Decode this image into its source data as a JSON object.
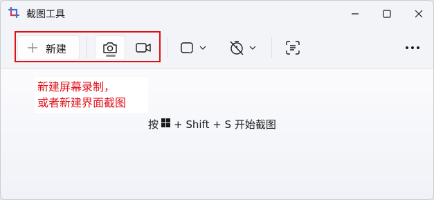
{
  "window": {
    "title": "截图工具",
    "icon": "snipping-tool-icon",
    "controls": [
      "minimize-icon",
      "maximize-icon",
      "close-icon"
    ]
  },
  "toolbar": {
    "new_label": "新建",
    "new_icon": "plus-icon",
    "modes": [
      {
        "name": "camera",
        "icon": "camera-icon",
        "selected": true
      },
      {
        "name": "video",
        "icon": "video-camera-icon",
        "selected": false
      }
    ],
    "tools": [
      "snip-shape-icon",
      "chevron-down-icon",
      "timer-icon",
      "chevron-down-icon",
      "text-actions-icon",
      "more-icon"
    ]
  },
  "annotation": {
    "line1": "新建屏幕录制，",
    "line2": "或者新建界面截图",
    "color": "#e0111a"
  },
  "hint": {
    "before": "按",
    "key_icon": "windows-logo-icon",
    "after": "+ Shift + S 开始截图"
  },
  "colors": {
    "highlight_border": "#e01010",
    "window_bg": "#f3f4f7"
  }
}
